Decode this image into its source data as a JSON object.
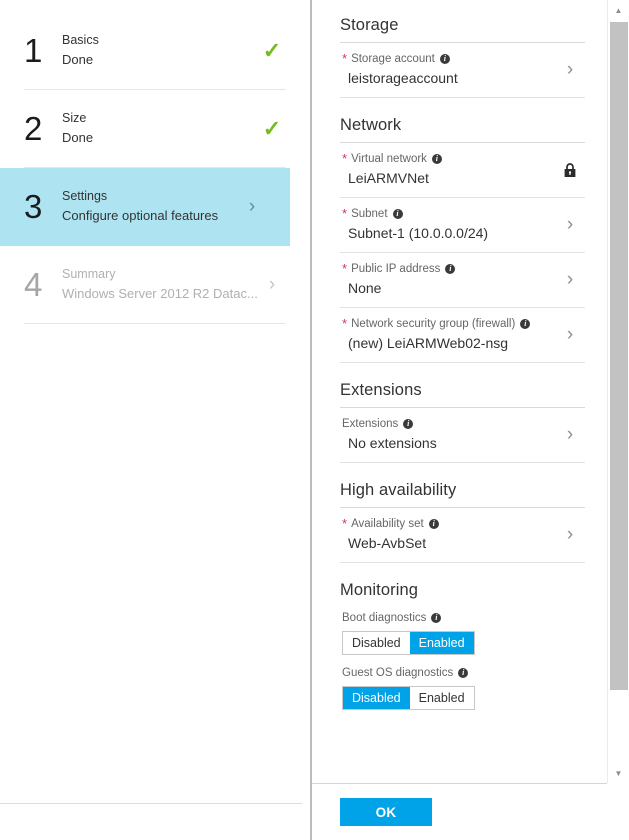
{
  "wizard": {
    "steps": [
      {
        "num": "1",
        "title": "Basics",
        "sub": "Done",
        "state": "done",
        "icon": "check-icon"
      },
      {
        "num": "2",
        "title": "Size",
        "sub": "Done",
        "state": "done",
        "icon": "check-icon"
      },
      {
        "num": "3",
        "title": "Settings",
        "sub": "Configure optional features",
        "state": "active",
        "icon": "chevron-right-icon"
      },
      {
        "num": "4",
        "title": "Summary",
        "sub": "Windows Server 2012 R2 Datac...",
        "state": "muted",
        "icon": "chevron-right-icon"
      }
    ],
    "check_glyph": "✓",
    "chevron_glyph": "›"
  },
  "blade": {
    "sections": [
      {
        "title": "Storage",
        "rows": [
          {
            "required": true,
            "label": "Storage account",
            "info": true,
            "value": "leistorageaccount",
            "action": "chevron-right-icon"
          }
        ]
      },
      {
        "title": "Network",
        "rows": [
          {
            "required": true,
            "label": "Virtual network",
            "info": true,
            "value": "LeiARMVNet",
            "action": "lock-icon"
          },
          {
            "required": true,
            "label": "Subnet",
            "info": true,
            "value": "Subnet-1 (10.0.0.0/24)",
            "action": "chevron-right-icon"
          },
          {
            "required": true,
            "label": "Public IP address",
            "info": true,
            "value": "None",
            "action": "chevron-right-icon"
          },
          {
            "required": true,
            "label": "Network security group (firewall)",
            "info": true,
            "value": "(new) LeiARMWeb02-nsg",
            "action": "chevron-right-icon"
          }
        ]
      },
      {
        "title": "Extensions",
        "rows": [
          {
            "required": false,
            "label": "Extensions",
            "info": true,
            "value": "No extensions",
            "action": "chevron-right-icon"
          }
        ]
      },
      {
        "title": "High availability",
        "highlighted": true,
        "rows": [
          {
            "required": true,
            "label": "Availability set",
            "info": true,
            "value": "Web-AvbSet",
            "action": "chevron-right-icon"
          }
        ]
      }
    ],
    "monitoring": {
      "title": "Monitoring",
      "toggles": [
        {
          "label": "Boot diagnostics",
          "info": true,
          "options": [
            "Disabled",
            "Enabled"
          ],
          "selected": "Enabled"
        },
        {
          "label": "Guest OS diagnostics",
          "info": true,
          "options": [
            "Disabled",
            "Enabled"
          ],
          "selected": "Disabled"
        }
      ]
    },
    "footer": {
      "ok_label": "OK"
    },
    "scrollbar": {
      "up_glyph": "▲",
      "down_glyph": "▼"
    }
  },
  "colors": {
    "accent_blue": "#00a2e8",
    "active_step": "#aee4f1",
    "check_green": "#76bc21",
    "required_star": "#d6336c",
    "highlight_red": "#ee1c25"
  },
  "info_glyph": "i"
}
